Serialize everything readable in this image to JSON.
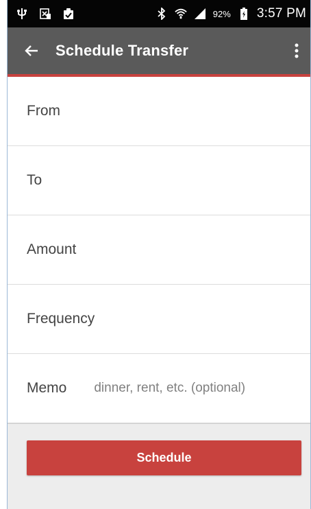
{
  "status_bar": {
    "battery_percent": "92%",
    "time": "3:57 PM",
    "icons": [
      "usb-icon",
      "excel-notification-icon",
      "clipboard-check-icon",
      "bluetooth-icon",
      "wifi-icon",
      "signal-icon",
      "battery-icon"
    ]
  },
  "app_bar": {
    "title": "Schedule Transfer",
    "back_icon": "arrow-left-icon",
    "overflow_icon": "more-vertical-icon"
  },
  "colors": {
    "app_bar": "#5a5a5a",
    "accent": "#c8423e",
    "status_bar": "#050505",
    "bottom_panel": "#ededed"
  },
  "form": {
    "from_label": "From",
    "to_label": "To",
    "amount_label": "Amount",
    "frequency_label": "Frequency",
    "memo_label": "Memo",
    "memo_placeholder": "dinner, rent, etc. (optional)"
  },
  "actions": {
    "schedule_label": "Schedule"
  }
}
